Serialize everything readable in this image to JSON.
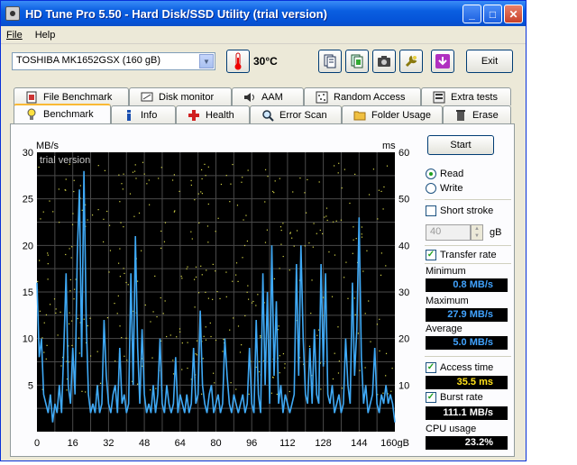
{
  "window": {
    "title": "HD Tune Pro 5.50 - Hard Disk/SSD Utility (trial version)",
    "controls": {
      "minimize": "_",
      "maximize": "□",
      "close": "✕"
    }
  },
  "menu": [
    "File",
    "Help"
  ],
  "toolbar": {
    "drive": "TOSHIBA MK1652GSX (160 gB)",
    "temperature": "30°C",
    "exit_label": "Exit",
    "icons": [
      "thermometer-icon",
      "copy-text-icon",
      "copy-info-icon",
      "screenshot-camera-icon",
      "options-wrench-icon",
      "save-download-icon"
    ]
  },
  "tabs_top": [
    {
      "label": "File Benchmark",
      "icon": "file-benchmark-icon"
    },
    {
      "label": "Disk monitor",
      "icon": "disk-monitor-icon"
    },
    {
      "label": "AAM",
      "icon": "speaker-icon"
    },
    {
      "label": "Random Access",
      "icon": "random-access-icon"
    },
    {
      "label": "Extra tests",
      "icon": "extra-tests-icon"
    }
  ],
  "tabs_bottom": [
    {
      "label": "Benchmark",
      "icon": "benchmark-bulb-icon",
      "active": true
    },
    {
      "label": "Info",
      "icon": "info-icon"
    },
    {
      "label": "Health",
      "icon": "health-cross-icon"
    },
    {
      "label": "Error Scan",
      "icon": "magnifier-icon"
    },
    {
      "label": "Folder Usage",
      "icon": "folder-icon"
    },
    {
      "label": "Erase",
      "icon": "trash-icon"
    }
  ],
  "side": {
    "start_label": "Start",
    "read_label": "Read",
    "write_label": "Write",
    "read_selected": true,
    "short_stroke_label": "Short stroke",
    "short_stroke_checked": false,
    "short_stroke_value": "40",
    "short_stroke_unit": "gB",
    "transfer_rate_label": "Transfer rate",
    "transfer_rate_checked": true,
    "minimum_label": "Minimum",
    "minimum_value": "0.8 MB/s",
    "maximum_label": "Maximum",
    "maximum_value": "27.9 MB/s",
    "average_label": "Average",
    "average_value": "5.0 MB/s",
    "access_time_label": "Access time",
    "access_time_checked": true,
    "access_time_value": "35.5 ms",
    "burst_rate_label": "Burst rate",
    "burst_rate_checked": true,
    "burst_rate_value": "111.1 MB/s",
    "cpu_label": "CPU usage",
    "cpu_value": "23.2%"
  },
  "chart_data": {
    "type": "line",
    "watermark": "trial version",
    "ylabel_left": "MB/s",
    "ylabel_right": "ms",
    "xunit": "gB",
    "xlim": [
      0,
      160
    ],
    "ylim_left": [
      0,
      30
    ],
    "ylim_right": [
      0,
      60
    ],
    "x_ticks": [
      "0",
      "16",
      "32",
      "48",
      "64",
      "80",
      "96",
      "112",
      "128",
      "144",
      "160gB"
    ],
    "y_ticks_left": [
      "30",
      "25",
      "20",
      "15",
      "10",
      "5"
    ],
    "y_ticks_right": [
      "60",
      "50",
      "40",
      "30",
      "20",
      "10"
    ],
    "grid": true,
    "colors": {
      "background": "#000000",
      "grid": "#4a4a4a",
      "transfer": "#3fa9f5",
      "access": "#d8d84a",
      "text": "#ffffff"
    },
    "series": [
      {
        "axis": "left",
        "values": [
          [
            0,
            16
          ],
          [
            1,
            8
          ],
          [
            2,
            10
          ],
          [
            3,
            4
          ],
          [
            4,
            3
          ],
          [
            5,
            2
          ],
          [
            6,
            4
          ],
          [
            7,
            1
          ],
          [
            8,
            3
          ],
          [
            9,
            2
          ],
          [
            10,
            5
          ],
          [
            11,
            2
          ],
          [
            12,
            9
          ],
          [
            13,
            17
          ],
          [
            14,
            5
          ],
          [
            15,
            3
          ],
          [
            16,
            9
          ],
          [
            17,
            4
          ],
          [
            18,
            19
          ],
          [
            19,
            26
          ],
          [
            20,
            8
          ],
          [
            21,
            28
          ],
          [
            22,
            12
          ],
          [
            23,
            4
          ],
          [
            24,
            2
          ],
          [
            25,
            3
          ],
          [
            26,
            2
          ],
          [
            27,
            5
          ],
          [
            28,
            2
          ],
          [
            29,
            3
          ],
          [
            30,
            12
          ],
          [
            31,
            6
          ],
          [
            32,
            3
          ],
          [
            33,
            2
          ],
          [
            34,
            4
          ],
          [
            35,
            5
          ],
          [
            36,
            2
          ],
          [
            37,
            9
          ],
          [
            38,
            3
          ],
          [
            39,
            4
          ],
          [
            40,
            2
          ],
          [
            41,
            3
          ],
          [
            42,
            17
          ],
          [
            43,
            5
          ],
          [
            44,
            21
          ],
          [
            45,
            9
          ],
          [
            46,
            3
          ],
          [
            47,
            11
          ],
          [
            48,
            4
          ],
          [
            49,
            2
          ],
          [
            50,
            3
          ],
          [
            51,
            2
          ],
          [
            52,
            5
          ],
          [
            53,
            2
          ],
          [
            54,
            4
          ],
          [
            55,
            10
          ],
          [
            56,
            3
          ],
          [
            57,
            2
          ],
          [
            58,
            5
          ],
          [
            59,
            3
          ],
          [
            60,
            2
          ],
          [
            61,
            3
          ],
          [
            62,
            8
          ],
          [
            63,
            2
          ],
          [
            64,
            4
          ],
          [
            65,
            3
          ],
          [
            66,
            2
          ],
          [
            67,
            4
          ],
          [
            68,
            2
          ],
          [
            69,
            3
          ],
          [
            70,
            9
          ],
          [
            71,
            3
          ],
          [
            72,
            4
          ],
          [
            73,
            13
          ],
          [
            74,
            5
          ],
          [
            75,
            3
          ],
          [
            76,
            2
          ],
          [
            77,
            4
          ],
          [
            78,
            5
          ],
          [
            79,
            2
          ],
          [
            80,
            3
          ],
          [
            81,
            4
          ],
          [
            82,
            2
          ],
          [
            83,
            3
          ],
          [
            84,
            10
          ],
          [
            85,
            6
          ],
          [
            86,
            3
          ],
          [
            87,
            2
          ],
          [
            88,
            4
          ],
          [
            89,
            3
          ],
          [
            90,
            2
          ],
          [
            91,
            3
          ],
          [
            92,
            4
          ],
          [
            93,
            2
          ],
          [
            94,
            3
          ],
          [
            95,
            9
          ],
          [
            96,
            3
          ],
          [
            97,
            2
          ],
          [
            98,
            12
          ],
          [
            99,
            4
          ],
          [
            100,
            2
          ],
          [
            101,
            17
          ],
          [
            102,
            5
          ],
          [
            103,
            15
          ],
          [
            104,
            3
          ],
          [
            105,
            20
          ],
          [
            106,
            6
          ],
          [
            107,
            14
          ],
          [
            108,
            3
          ],
          [
            109,
            5
          ],
          [
            110,
            2
          ],
          [
            111,
            4
          ],
          [
            112,
            3
          ],
          [
            113,
            2
          ],
          [
            114,
            3
          ],
          [
            115,
            4
          ],
          [
            116,
            18
          ],
          [
            117,
            6
          ],
          [
            118,
            20
          ],
          [
            119,
            10
          ],
          [
            120,
            4
          ],
          [
            121,
            3
          ],
          [
            122,
            9
          ],
          [
            123,
            3
          ],
          [
            124,
            11
          ],
          [
            125,
            4
          ],
          [
            126,
            3
          ],
          [
            127,
            18
          ],
          [
            128,
            7
          ],
          [
            129,
            17
          ],
          [
            130,
            4
          ],
          [
            131,
            3
          ],
          [
            132,
            5
          ],
          [
            133,
            2
          ],
          [
            134,
            3
          ],
          [
            135,
            4
          ],
          [
            136,
            2
          ],
          [
            137,
            3
          ],
          [
            138,
            10
          ],
          [
            139,
            5
          ],
          [
            140,
            3
          ],
          [
            141,
            16
          ],
          [
            142,
            6
          ],
          [
            143,
            11
          ],
          [
            144,
            23
          ],
          [
            145,
            8
          ],
          [
            146,
            3
          ],
          [
            147,
            5
          ],
          [
            148,
            2
          ],
          [
            149,
            3
          ],
          [
            150,
            4
          ],
          [
            151,
            9
          ],
          [
            152,
            3
          ],
          [
            153,
            2
          ],
          [
            154,
            4
          ],
          [
            155,
            3
          ],
          [
            156,
            5
          ],
          [
            157,
            3
          ],
          [
            158,
            4
          ],
          [
            159,
            3
          ],
          [
            160,
            1
          ]
        ]
      }
    ],
    "scatter_axis": "right",
    "scatter_note": "access time points scattered mostly between 10 and 58 ms"
  }
}
